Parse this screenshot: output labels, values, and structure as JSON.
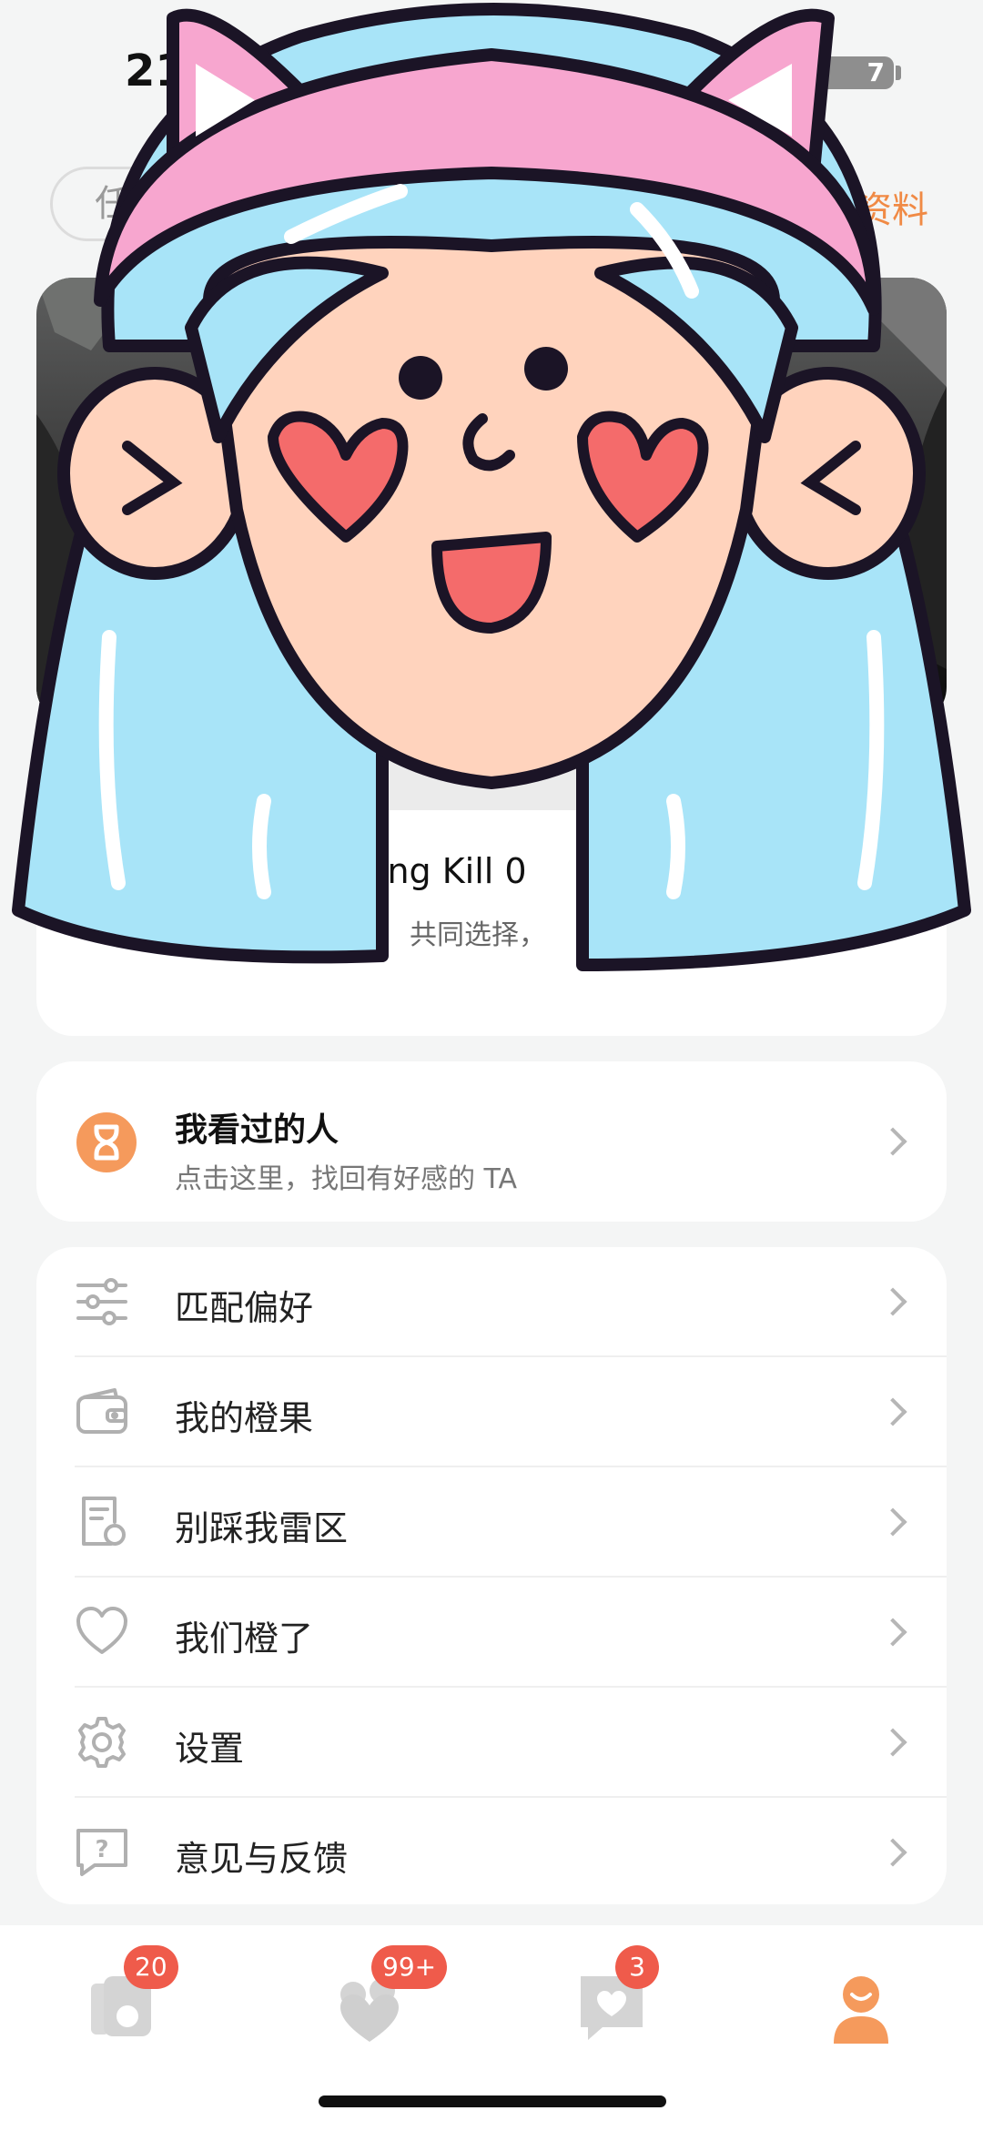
{
  "status_bar": {
    "time": "21",
    "battery": "7"
  },
  "header": {
    "task_button": "任",
    "edit_profile": "资料"
  },
  "game_card": {
    "title": "ting Kill 0",
    "description": "共同选择，"
  },
  "viewed": {
    "title": "我看过的人",
    "subtitle": "点击这里，找回有好感的 TA"
  },
  "menu": [
    {
      "label": "匹配偏好",
      "icon": "sliders-icon"
    },
    {
      "label": "我的橙果",
      "icon": "wallet-icon"
    },
    {
      "label": "别踩我雷区",
      "icon": "document-icon"
    },
    {
      "label": "我们橙了",
      "icon": "heart-icon"
    },
    {
      "label": "设置",
      "icon": "gear-icon"
    },
    {
      "label": "意见与反馈",
      "icon": "feedback-icon"
    }
  ],
  "tabs": [
    {
      "name": "cards",
      "badge": "20"
    },
    {
      "name": "likes",
      "badge": "99+"
    },
    {
      "name": "messages",
      "badge": "3"
    },
    {
      "name": "profile",
      "badge": ""
    }
  ],
  "colors": {
    "accent": "#F08A45",
    "badge": "#EF5B4B",
    "sticker_hair": "#A8E4F8",
    "sticker_band": "#F7A6CF"
  }
}
